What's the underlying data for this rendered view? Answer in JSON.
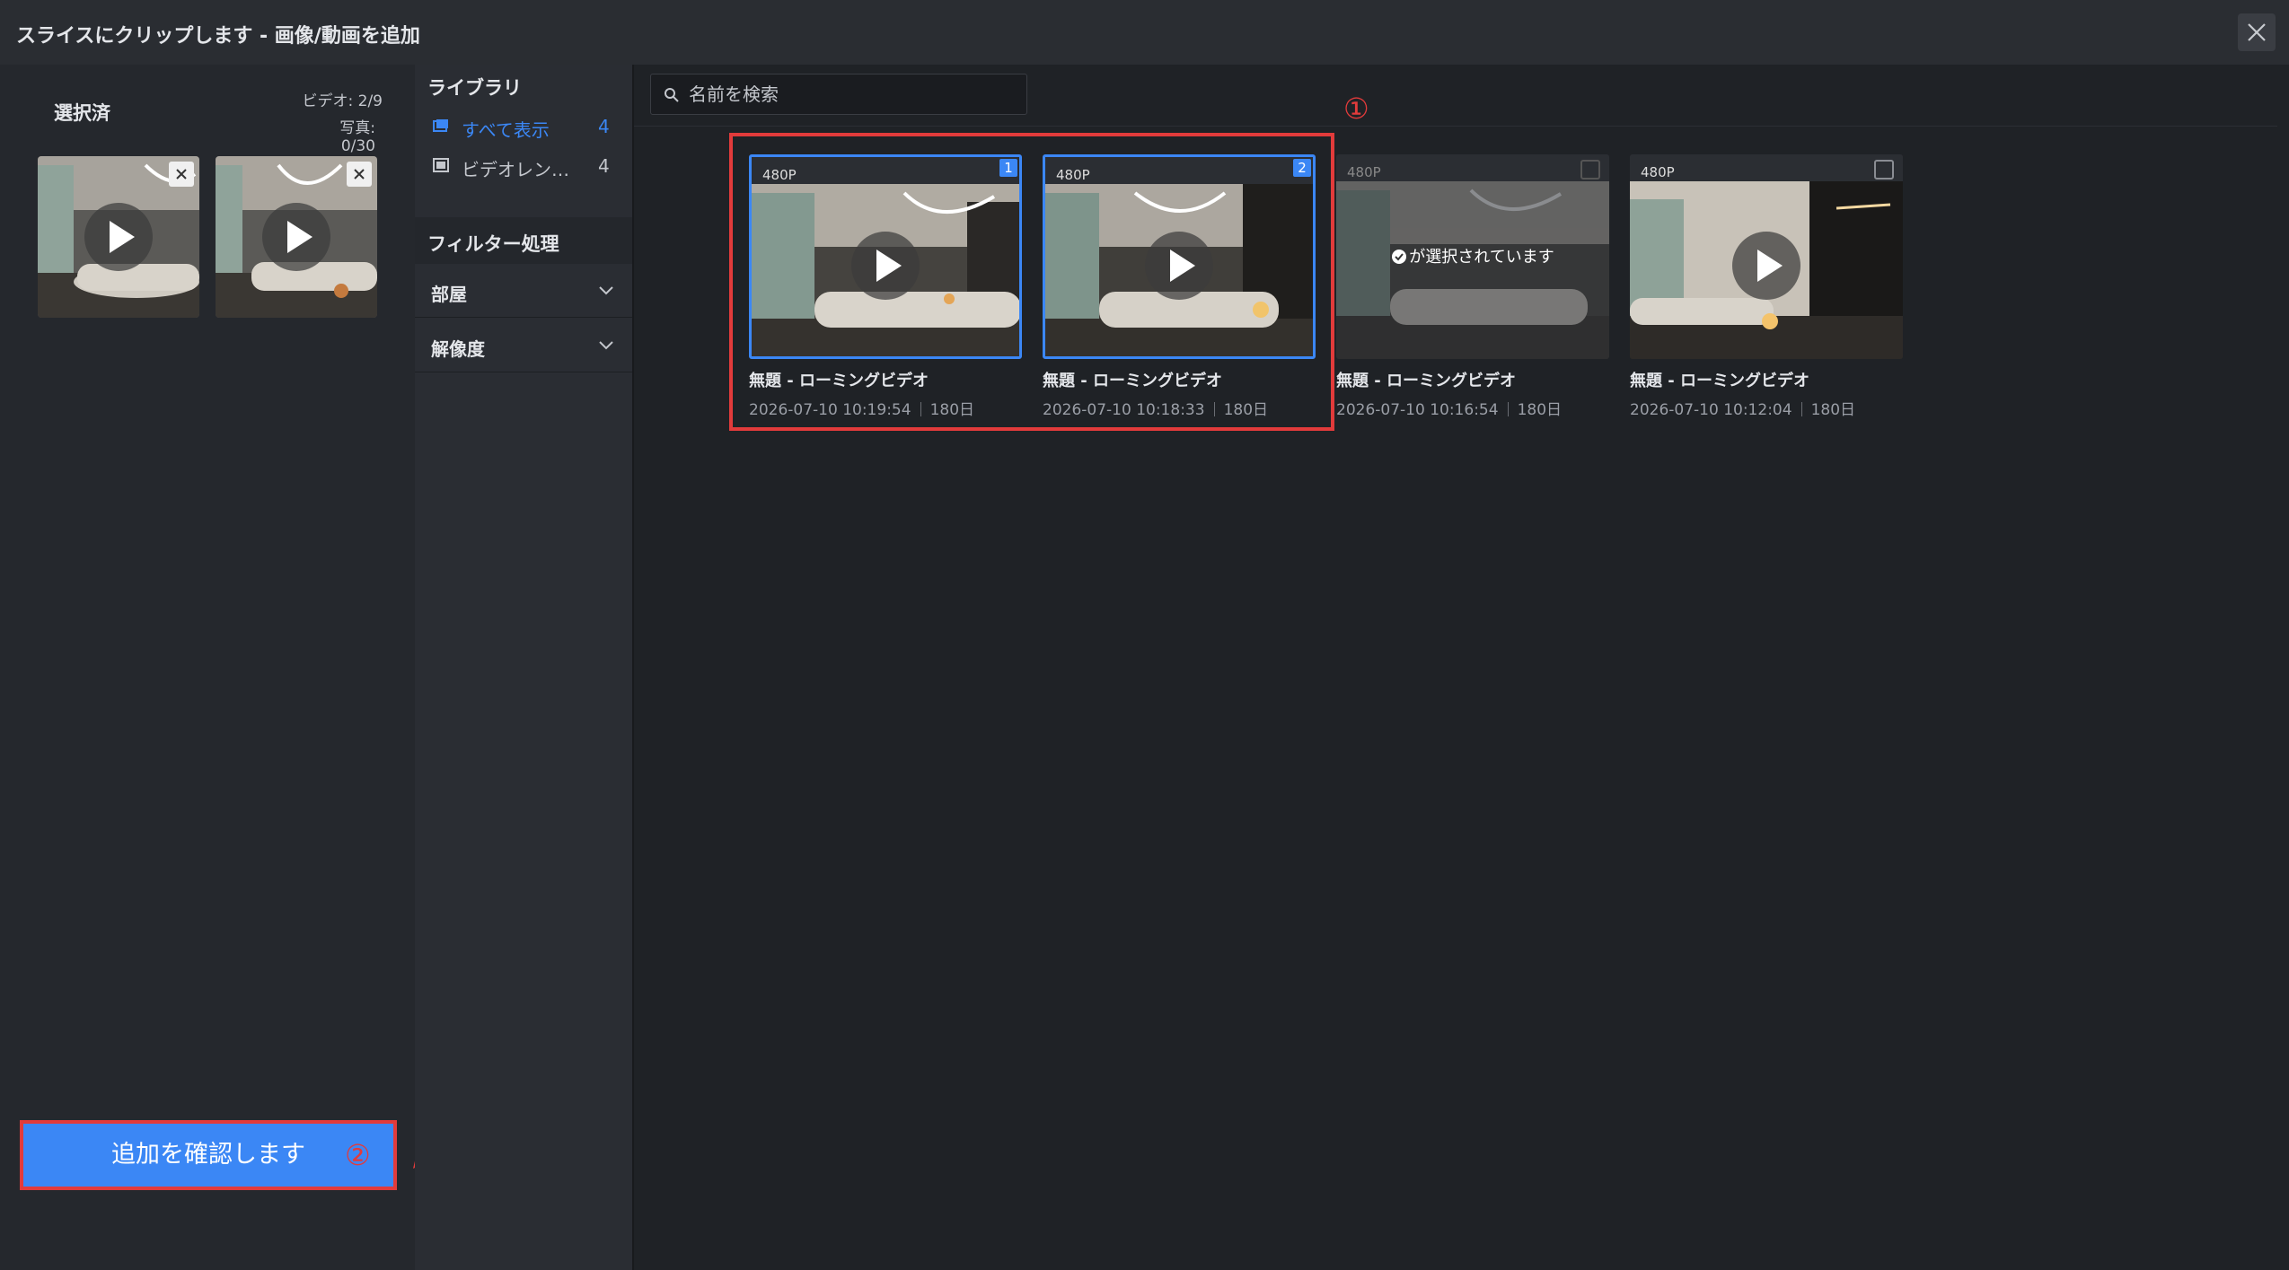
{
  "dialog": {
    "title": "スライスにクリップします - 画像/動画を追加",
    "close_icon": "close-icon"
  },
  "selected": {
    "title": "選択済",
    "video_count": "ビデオ: 2/9",
    "photo_count": "写真: 0/30",
    "items": [
      {
        "id": 1
      },
      {
        "id": 2
      }
    ],
    "confirm_label": "追加を確認します",
    "annotation": "②"
  },
  "library": {
    "title": "ライブラリ",
    "items": [
      {
        "label": "すべて表示",
        "count": "4",
        "icon": "gallery-icon",
        "active": true
      },
      {
        "label": "ビデオレン…",
        "count": "4",
        "icon": "film-icon",
        "active": false
      }
    ],
    "filter_title": "フィルター処理",
    "filters": [
      {
        "label": "部屋"
      },
      {
        "label": "解像度"
      }
    ]
  },
  "main": {
    "search_placeholder": "名前を検索",
    "annotation": "①",
    "cards": [
      {
        "resolution": "480P",
        "name": "無題 - ローミングビデオ",
        "date": "2026-07-10 10:19:54",
        "duration": "180日",
        "selected": true,
        "badge": "1",
        "disabled": false
      },
      {
        "resolution": "480P",
        "name": "無題 - ローミングビデオ",
        "date": "2026-07-10 10:18:33",
        "duration": "180日",
        "selected": true,
        "badge": "2",
        "disabled": false
      },
      {
        "resolution": "480P",
        "name": "無題 - ローミングビデオ",
        "date": "2026-07-10 10:16:54",
        "duration": "180日",
        "selected": false,
        "badge": "",
        "disabled": true,
        "disabled_label": "が選択されています"
      },
      {
        "resolution": "480P",
        "name": "無題 - ローミングビデオ",
        "date": "2026-07-10 10:12:04",
        "duration": "180日",
        "selected": false,
        "badge": "",
        "disabled": false
      }
    ]
  },
  "colors": {
    "accent": "#3b87f5",
    "annotation_red": "#e23b3b",
    "panel": "#25282d",
    "background": "#1f2226"
  }
}
